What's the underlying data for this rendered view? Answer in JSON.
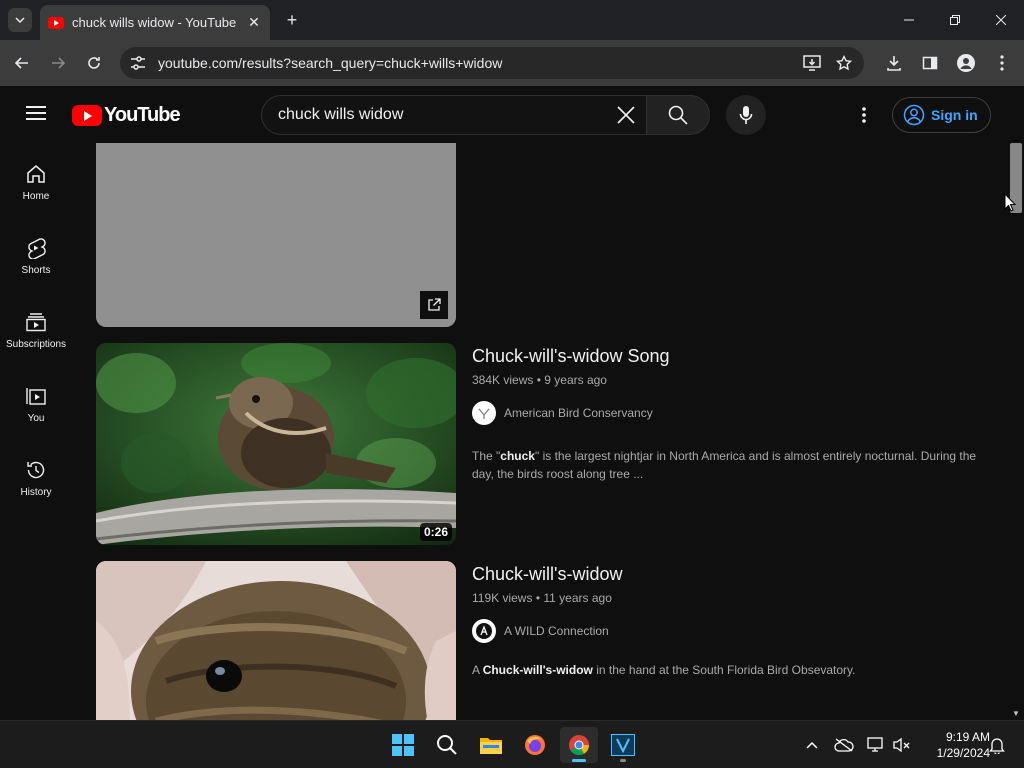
{
  "browser": {
    "tab_title": "chuck wills widow - YouTube",
    "url": "youtube.com/results?search_query=chuck+wills+widow"
  },
  "header": {
    "logo_text": "YouTube",
    "search_value": "chuck wills widow",
    "signin_label": "Sign in"
  },
  "nav": {
    "items": [
      {
        "label": "Home",
        "icon": "home-icon"
      },
      {
        "label": "Shorts",
        "icon": "shorts-icon"
      },
      {
        "label": "Subscriptions",
        "icon": "subscriptions-icon"
      },
      {
        "label": "You",
        "icon": "you-icon"
      },
      {
        "label": "History",
        "icon": "history-icon"
      }
    ]
  },
  "results": [
    {
      "title": "Chuck-will's-widow Song",
      "views": "384K views",
      "age": "9 years ago",
      "channel": "American Bird Conservancy",
      "duration": "0:26",
      "desc_pre": "The \"",
      "desc_bold": "chuck",
      "desc_post": "\" is the largest nightjar in North America and is almost entirely nocturnal. During the day, the birds roost along tree ..."
    },
    {
      "title": "Chuck-will's-widow",
      "views": "119K views",
      "age": "11 years ago",
      "channel": "A WILD Connection",
      "desc_pre": "A ",
      "desc_bold": "Chuck-will's-widow",
      "desc_post": " in the hand at the South Florida Bird Obsevatory."
    }
  ],
  "taskbar": {
    "time": "9:19 AM",
    "date": "1/29/2024"
  },
  "colors": {
    "brand_red": "#ff0000",
    "link_blue": "#3ea6ff",
    "background": "#0f0f0f"
  }
}
